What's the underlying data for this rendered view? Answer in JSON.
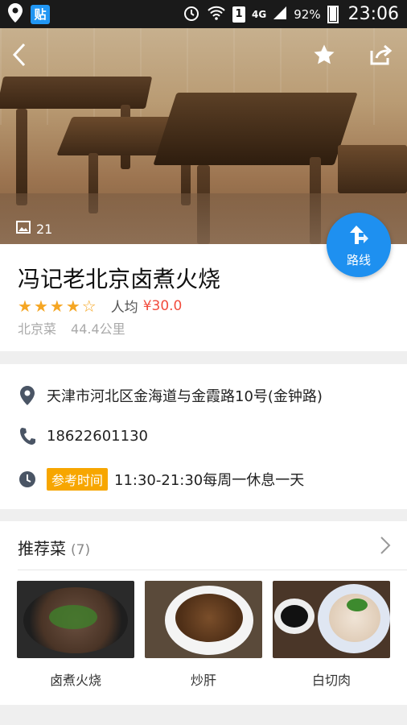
{
  "status_bar": {
    "badge": "贴",
    "sim": "1",
    "network": "4G",
    "battery": "92%",
    "time": "23:06"
  },
  "hero": {
    "photo_count": "21"
  },
  "route_button": {
    "label": "路线"
  },
  "restaurant": {
    "name": "冯记老北京卤煮火烧",
    "rating": 4,
    "rating_max": 5,
    "avg_label": "人均",
    "avg_price": "¥30.0",
    "cuisine": "北京菜",
    "distance": "44.4公里"
  },
  "details": {
    "address": "天津市河北区金海道与金霞路10号(金钟路)",
    "phone": "18622601130",
    "hours_tag": "参考时间",
    "hours": "11:30-21:30每周一休息一天"
  },
  "recommended": {
    "title": "推荐菜",
    "count": "(7)",
    "dishes": [
      {
        "name": "卤煮火烧"
      },
      {
        "name": "炒肝"
      },
      {
        "name": "白切肉"
      }
    ]
  },
  "colors": {
    "accent_blue": "#1e90f0",
    "price_red": "#f24c3d",
    "star_orange": "#f5a623",
    "tag_orange": "#f7a600"
  }
}
